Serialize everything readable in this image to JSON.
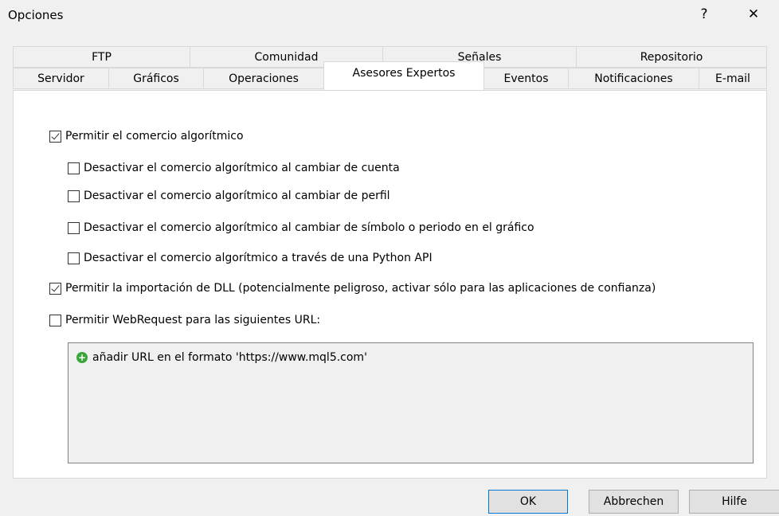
{
  "window": {
    "title": "Opciones",
    "help_glyph": "?",
    "close_glyph": "✕"
  },
  "tabs": {
    "top_row": [
      "FTP",
      "Comunidad",
      "Señales",
      "Repositorio"
    ],
    "bottom_row": [
      "Servidor",
      "Gráficos",
      "Operaciones",
      "Asesores Expertos",
      "Eventos",
      "Notificaciones",
      "E-mail"
    ],
    "active": "Asesores Expertos"
  },
  "options": [
    {
      "label": "Permitir el comercio algorítmico",
      "checked": true
    },
    {
      "label": "Desactivar el comercio algorítmico al cambiar de cuenta",
      "checked": false
    },
    {
      "label": "Desactivar el comercio algorítmico al cambiar de perfil",
      "checked": false
    },
    {
      "label": "Desactivar el comercio algorítmico al cambiar de símbolo o periodo en el gráfico",
      "checked": false
    },
    {
      "label": "Desactivar el comercio algorítmico a través de una Python API",
      "checked": false
    },
    {
      "label": "Permitir la importación de DLL (potencialmente peligroso, activar sólo para las aplicaciones de confianza)",
      "checked": true
    },
    {
      "label": "Permitir WebRequest para las siguientes URL:",
      "checked": false
    }
  ],
  "url_list": {
    "add_label": "añadir URL en el formato 'https://www.mql5.com'",
    "add_icon": "plus-circle-icon"
  },
  "buttons": {
    "ok": "OK",
    "cancel": "Abbrechen",
    "help": "Hilfe"
  },
  "colors": {
    "dialog_bg": "#f0f0f0",
    "panel_bg": "#ffffff",
    "add_icon": "#3aa63a",
    "ok_border": "#0078d7"
  }
}
